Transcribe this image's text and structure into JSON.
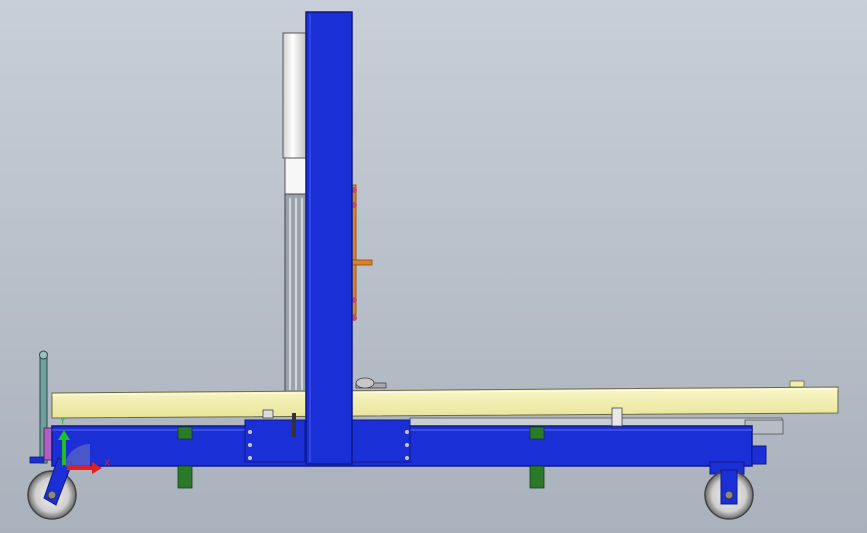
{
  "colors": {
    "background_top": "#c9cfd8",
    "background_bottom": "#a9b1bc",
    "frame_blue": "#1a2fd6",
    "frame_blue_dark": "#0d1a8a",
    "deck_yellow": "#f6f3b4",
    "cylinder_white": "#f4f4f4",
    "handle_orange": "#d9822b",
    "bracket_green": "#2a7a2a",
    "wheel_grey": "#d9d9d9",
    "axis_x": "#e02020",
    "axis_y": "#20c020"
  },
  "triad": {
    "x_label": "X",
    "y_label": "Y",
    "icon": "coordinate-triad-icon"
  },
  "parts": [
    "vertical-column",
    "lift-cylinder",
    "handle",
    "deck-platform",
    "base-frame",
    "front-wheel",
    "rear-wheel",
    "push-handle",
    "support-brackets"
  ]
}
